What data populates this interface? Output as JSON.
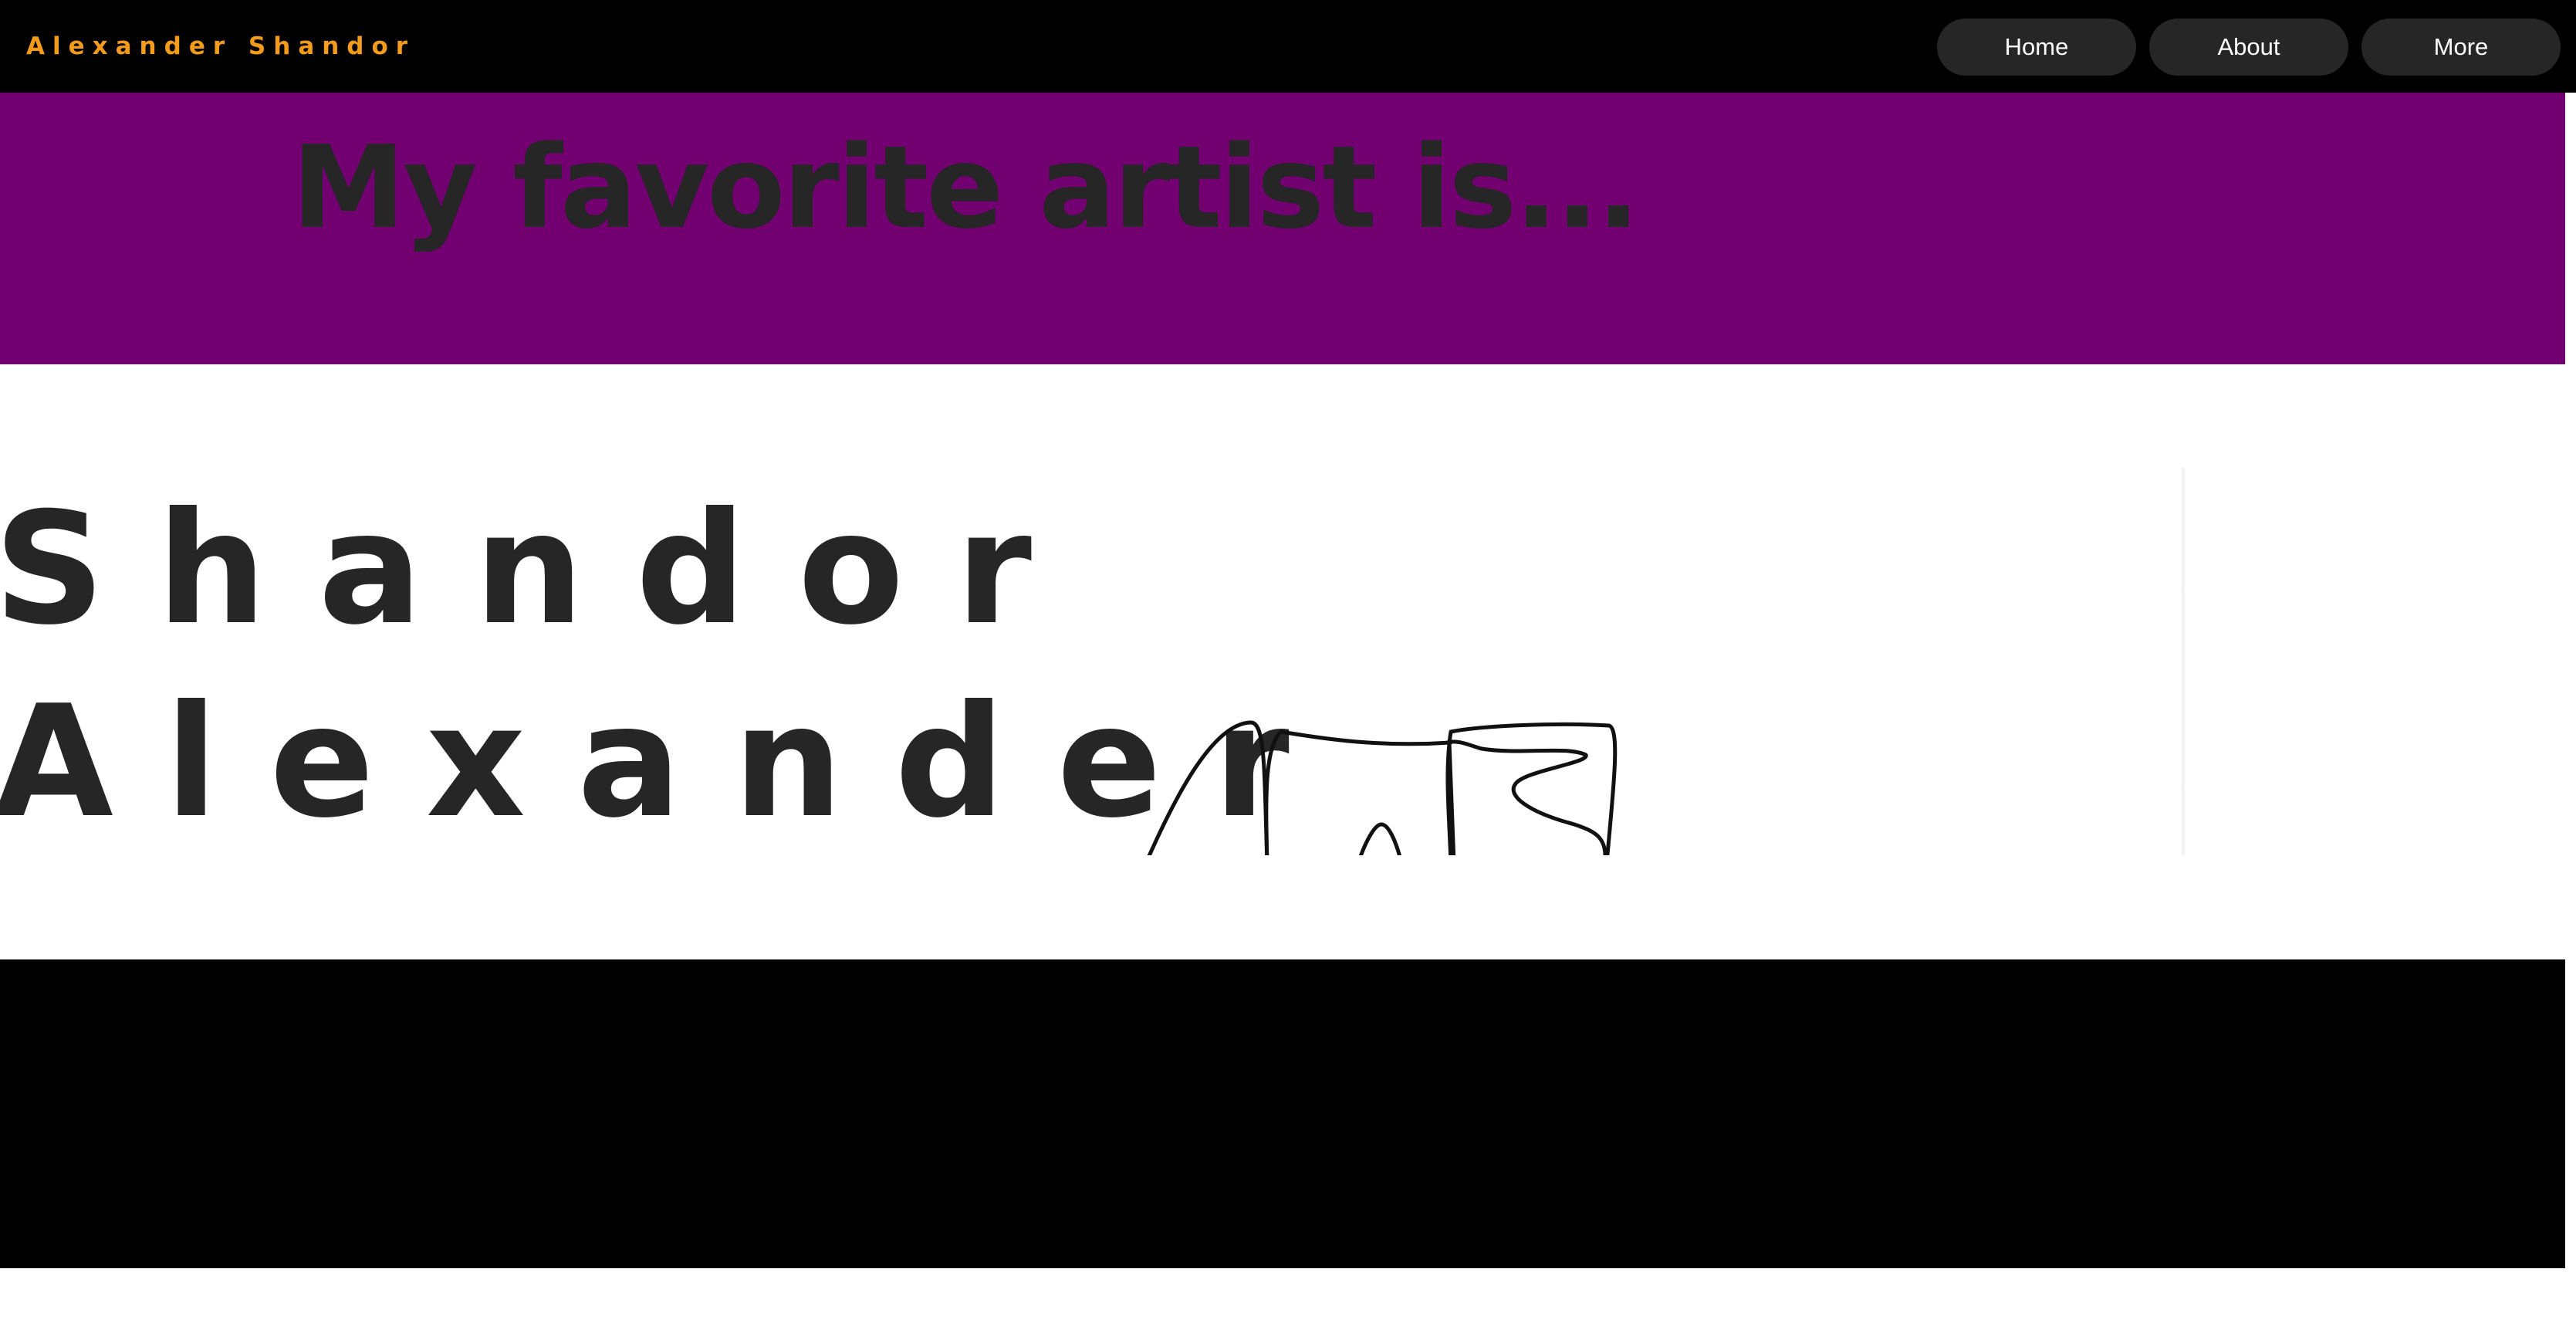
{
  "header": {
    "site_name": "Alexander Shandor",
    "nav": [
      {
        "label": "Home"
      },
      {
        "label": "About"
      },
      {
        "label": "More"
      }
    ]
  },
  "banner": {
    "title": "My favorite artist is..."
  },
  "artist": {
    "name_line_1": "Shandor",
    "name_line_2": "Alexander",
    "signature": "Alexander Shandor signature (hand-drawn)"
  },
  "colors": {
    "site_name": "#f39c1b",
    "header_bg": "#000000",
    "nav_button_bg": "#262626",
    "banner_bg": "#730070",
    "text_dark": "#262626",
    "footer_bg": "#000000"
  }
}
